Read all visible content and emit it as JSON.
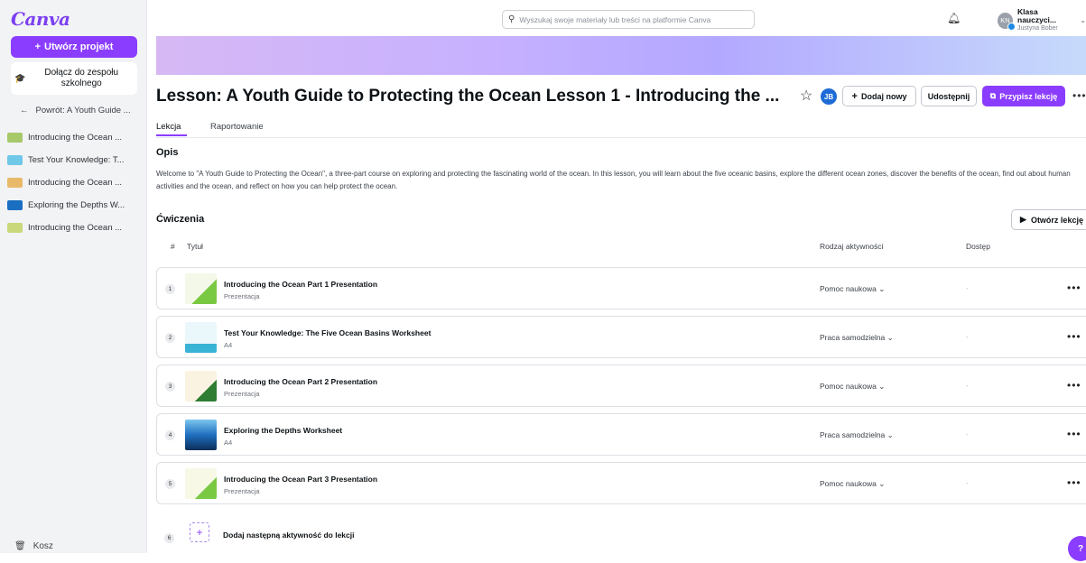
{
  "sidebar": {
    "logo": "Canva",
    "create_label": "Utwórz projekt",
    "team_label": "Dołącz do zespołu szkolnego",
    "back_label": "Powrót: A Youth Guide ...",
    "items": [
      {
        "label": "Introducing the Ocean ...",
        "thumb_color": "#a7c96a"
      },
      {
        "label": "Test Your Knowledge: T...",
        "thumb_color": "#6fc8e8"
      },
      {
        "label": "Introducing the Ocean ...",
        "thumb_color": "#e9b96a"
      },
      {
        "label": "Exploring the Depths W...",
        "thumb_color": "#1b6fc2"
      },
      {
        "label": "Introducing the Ocean ...",
        "thumb_color": "#c9d87b"
      }
    ],
    "trash_label": "Kosz"
  },
  "topbar": {
    "search_placeholder": "Wyszukaj swoje materiały lub treści na platformie Canva",
    "account_name": "Klasa nauczyci...",
    "account_user": "Justyna Bober",
    "avatar_initials": "KN"
  },
  "header": {
    "title": "Lesson: A Youth Guide to Protecting the Ocean Lesson 1 - Introducing the ...",
    "jb_initials": "JB",
    "add_new_label": "Dodaj nowy",
    "share_label": "Udostępnij",
    "assign_label": "Przypisz lekcję"
  },
  "tabs": [
    {
      "label": "Lekcja",
      "active": true
    },
    {
      "label": "Raportowanie",
      "active": false
    }
  ],
  "description": {
    "heading": "Opis",
    "text": "Welcome to \"A Youth Guide to Protecting the Ocean\", a three-part course on exploring and protecting the fascinating world of the ocean. In this lesson, you will learn about the five oceanic basins, explore the different ocean zones, discover the benefits of the ocean, find out about human activities and the ocean, and reflect on how you can help protect the ocean."
  },
  "exercises": {
    "heading": "Ćwiczenia",
    "open_label": "Otwórz lekcję",
    "col_num": "#",
    "col_title": "Tytuł",
    "col_type": "Rodzaj aktywności",
    "col_access": "Dostęp",
    "rows": [
      {
        "num": "1",
        "title": "Introducing the Ocean Part 1 Presentation",
        "sub": "Prezentacja",
        "activity": "Pomoc naukowa",
        "access": "-",
        "thumb": "#c8e6a0"
      },
      {
        "num": "2",
        "title": "Test Your Knowledge: The Five Ocean Basins Worksheet",
        "sub": "A4",
        "activity": "Praca samodzielna",
        "access": "-",
        "thumb": "#bfe8f3"
      },
      {
        "num": "3",
        "title": "Introducing the Ocean Part 2 Presentation",
        "sub": "Prezentacja",
        "activity": "Pomoc naukowa",
        "access": "-",
        "thumb": "#f3e4c4"
      },
      {
        "num": "4",
        "title": "Exploring the Depths Worksheet",
        "sub": "A4",
        "activity": "Praca samodzielna",
        "access": "-",
        "thumb": "#1f6fbf"
      },
      {
        "num": "5",
        "title": "Introducing the Ocean Part 3 Presentation",
        "sub": "Prezentacja",
        "activity": "Pomoc naukowa",
        "access": "-",
        "thumb": "#e8efc4"
      }
    ],
    "add_num": "6",
    "add_label": "Dodaj następną aktywność do lekcji"
  },
  "fab_label": "?"
}
